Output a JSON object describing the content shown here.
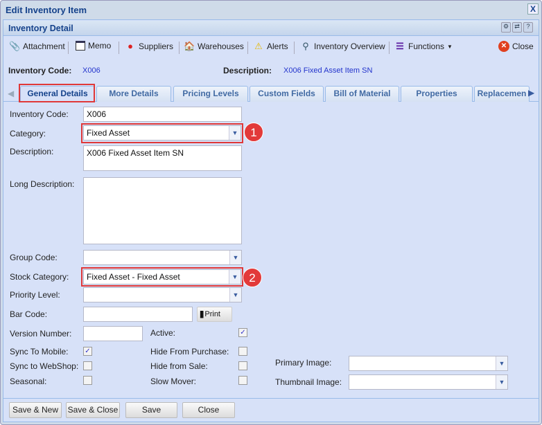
{
  "window": {
    "title": "Edit Inventory Item",
    "close": "X"
  },
  "panel": {
    "title": "Inventory Detail",
    "tools": [
      "⚙",
      "⇄",
      "?"
    ]
  },
  "toolbar": {
    "attachment": "Attachment",
    "memo": "Memo",
    "suppliers": "Suppliers",
    "warehouses": "Warehouses",
    "alerts": "Alerts",
    "overview": "Inventory Overview",
    "functions": "Functions",
    "close": "Close"
  },
  "info": {
    "code_label": "Inventory Code:",
    "code": "X006",
    "desc_label": "Description:",
    "desc": "X006 Fixed Asset Item SN"
  },
  "tabs": [
    "General Details",
    "More Details",
    "Pricing Levels",
    "Custom Fields",
    "Bill of Material",
    "Properties",
    "Replacemen"
  ],
  "form": {
    "inventory_code_label": "Inventory Code:",
    "inventory_code": "X006",
    "category_label": "Category:",
    "category": "Fixed Asset",
    "description_label": "Description:",
    "description": "X006 Fixed Asset Item SN",
    "long_description_label": "Long Description:",
    "long_description": "",
    "group_code_label": "Group Code:",
    "group_code": "",
    "stock_category_label": "Stock Category:",
    "stock_category": "Fixed Asset - Fixed Asset",
    "priority_label": "Priority Level:",
    "priority": "",
    "bar_code_label": "Bar Code:",
    "bar_code": "",
    "print": "Print",
    "version_label": "Version Number:",
    "version": "",
    "active_label": "Active:",
    "active": true,
    "sync_mobile_label": "Sync To Mobile:",
    "sync_mobile": true,
    "sync_webshop_label": "Sync to WebShop:",
    "sync_webshop": false,
    "seasonal_label": "Seasonal:",
    "seasonal": false,
    "hide_purchase_label": "Hide From Purchase:",
    "hide_purchase": false,
    "hide_sale_label": "Hide from Sale:",
    "hide_sale": false,
    "slow_mover_label": "Slow Mover:",
    "slow_mover": false,
    "primary_image_label": "Primary Image:",
    "thumbnail_image_label": "Thumbnail Image:"
  },
  "callouts": [
    "1",
    "2"
  ],
  "buttons": {
    "save_new": "Save & New",
    "save_close": "Save & Close",
    "save": "Save",
    "close": "Close"
  }
}
